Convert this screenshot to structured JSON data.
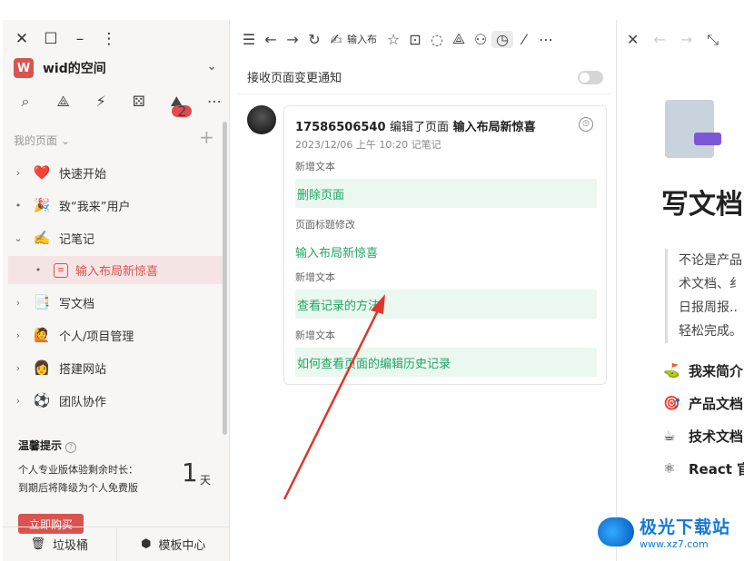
{
  "sidebar": {
    "workspace": {
      "avatar_letter": "W",
      "name": "wid的空间"
    },
    "section_title": "我的页面",
    "nav": [
      {
        "emoji": "❤️",
        "label": "快速开始"
      },
      {
        "emoji": "🎉",
        "label": "致“我来”用户"
      },
      {
        "emoji": "✍️",
        "label": "记笔记"
      },
      {
        "emoji": "",
        "label": "输入布局新惊喜"
      },
      {
        "emoji": "📑",
        "label": "写文档"
      },
      {
        "emoji": "🙋",
        "label": "个人/项目管理"
      },
      {
        "emoji": "👩",
        "label": "搭建网站"
      },
      {
        "emoji": "⚽",
        "label": "团队协作"
      }
    ],
    "tool_badge": "2",
    "tip": {
      "title": "温馨提示",
      "line1": "个人专业版体验剩余时长：",
      "line2": "到期后将降级为个人免费版",
      "days": "1",
      "unit": "天",
      "buy_label": "立即购买"
    },
    "bottom": {
      "trash": "垃圾桶",
      "templates": "模板中心"
    }
  },
  "mid": {
    "toolbar_title": "输入布",
    "notify_label": "接收页面变更通知",
    "history": {
      "user": "17586506540",
      "action": "编辑了页面",
      "page": "输入布局新惊喜",
      "date": "2023/12/06 上午 10:20",
      "source": "记笔记",
      "changes": [
        {
          "type": "新增文本",
          "value": "删除页面"
        },
        {
          "type": "页面标题修改",
          "value": "输入布局新惊喜"
        },
        {
          "type": "新增文本",
          "value": "查看记录的方法"
        },
        {
          "type": "新增文本",
          "value": "如何查看页面的编辑历史记录"
        }
      ]
    }
  },
  "right": {
    "title": "写文档",
    "quote_lines": [
      "不论是产品",
      "术文档、纟",
      "日报周报..",
      "轻松完成。"
    ],
    "links": [
      {
        "emoji": "⛳",
        "label": "我来简介"
      },
      {
        "emoji": "🎯",
        "label": "产品文档"
      },
      {
        "emoji": "☕",
        "label": "技术文档"
      },
      {
        "emoji": "⚛",
        "label": "React 官"
      }
    ]
  },
  "watermark": {
    "name": "极光下载站",
    "url": "www.xz7.com"
  },
  "colors": {
    "accent": "#d9534f",
    "green": "#21a366",
    "annotation_arrow": "#e0352b"
  }
}
